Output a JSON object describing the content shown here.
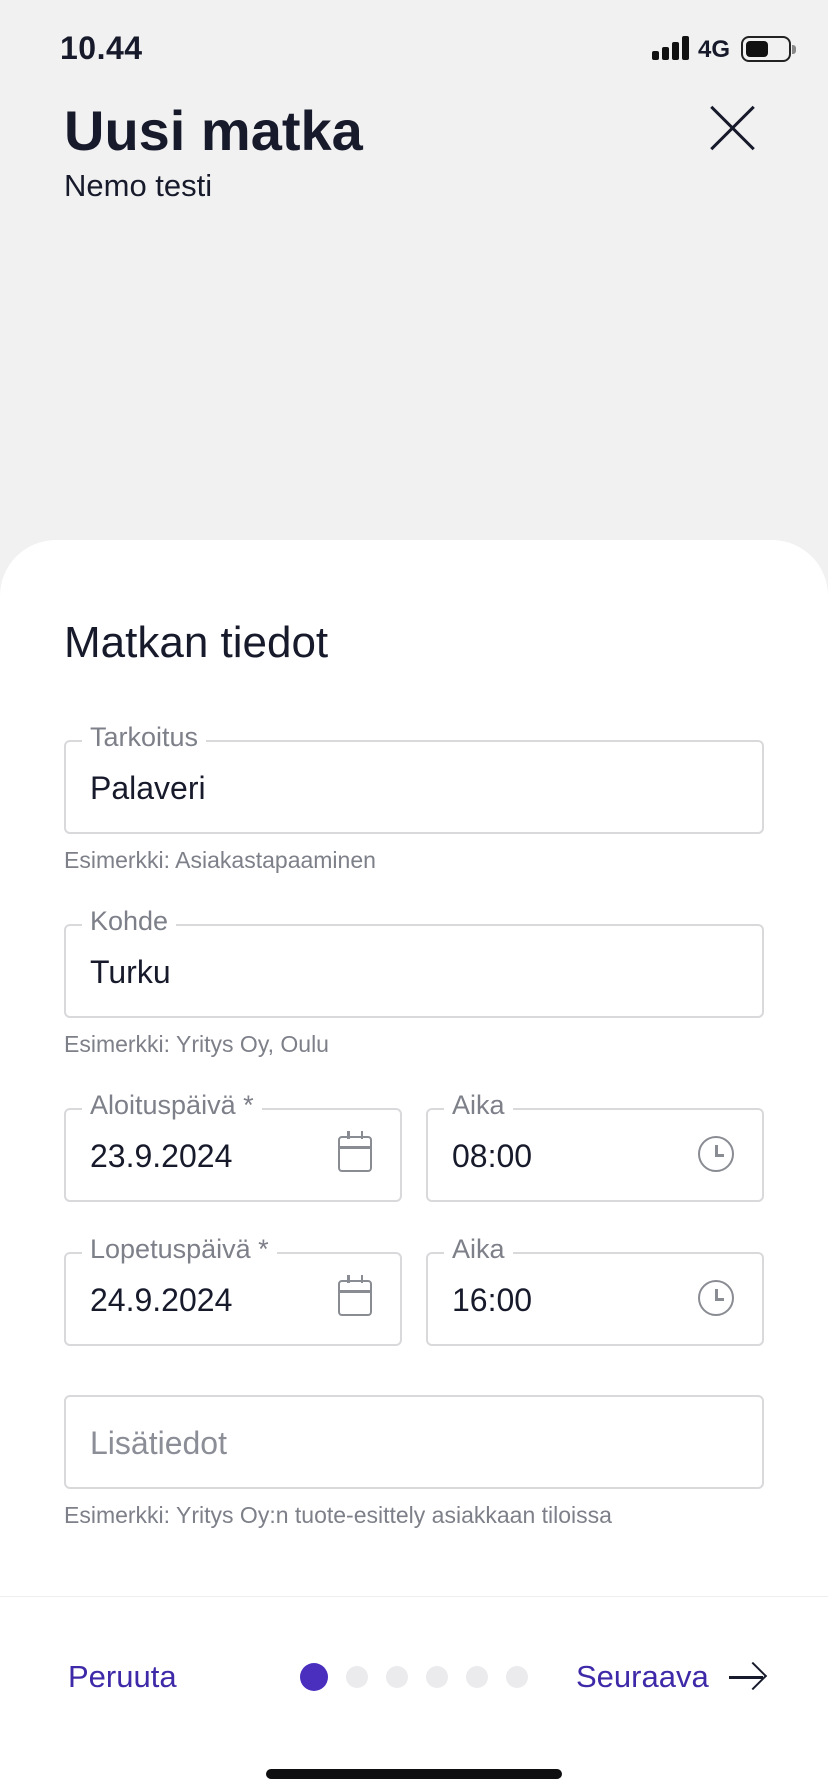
{
  "status_bar": {
    "time": "10.44",
    "network": "4G"
  },
  "header": {
    "title": "Uusi matka",
    "subtitle": "Nemo testi",
    "close_icon": "close-icon"
  },
  "form": {
    "section_title": "Matkan tiedot",
    "purpose": {
      "label": "Tarkoitus",
      "value": "Palaveri",
      "helper": "Esimerkki: Asiakastapaaminen"
    },
    "destination": {
      "label": "Kohde",
      "value": "Turku",
      "helper": "Esimerkki: Yritys Oy, Oulu"
    },
    "start_date": {
      "label": "Aloituspäivä *",
      "value": "23.9.2024",
      "icon": "calendar-icon"
    },
    "start_time": {
      "label": "Aika",
      "value": "08:00",
      "icon": "clock-icon"
    },
    "end_date": {
      "label": "Lopetuspäivä *",
      "value": "24.9.2024",
      "icon": "calendar-icon"
    },
    "end_time": {
      "label": "Aika",
      "value": "16:00",
      "icon": "clock-icon"
    },
    "details": {
      "placeholder": "Lisätiedot",
      "helper": "Esimerkki: Yritys Oy:n tuote-esittely asiakkaan tiloissa"
    }
  },
  "footer": {
    "cancel_label": "Peruuta",
    "next_label": "Seuraava",
    "steps_total": 6,
    "current_step": 1,
    "accent_color": "#4a2fbf"
  }
}
